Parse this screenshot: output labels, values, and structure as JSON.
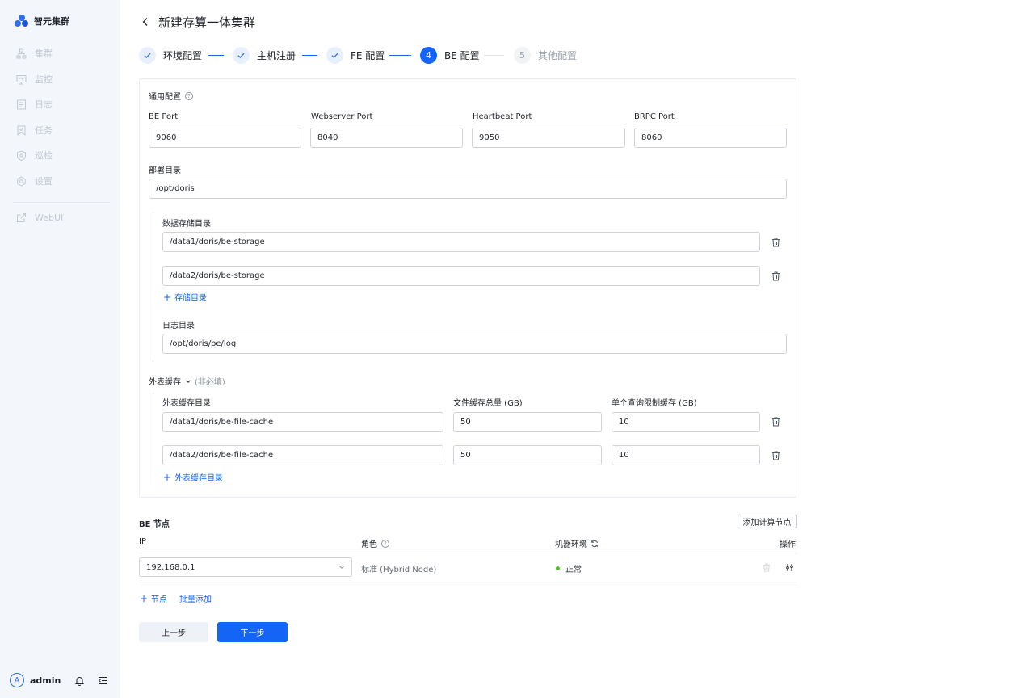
{
  "app": {
    "brand": "智元集群"
  },
  "sidebar": {
    "items": [
      {
        "label": "集群",
        "icon": "cluster-icon"
      },
      {
        "label": "监控",
        "icon": "monitor-icon"
      },
      {
        "label": "日志",
        "icon": "log-icon"
      },
      {
        "label": "任务",
        "icon": "task-icon"
      },
      {
        "label": "巡检",
        "icon": "inspect-icon"
      },
      {
        "label": "设置",
        "icon": "settings-icon"
      }
    ],
    "webui": {
      "label": "WebUI",
      "icon": "external-link-icon"
    },
    "user": {
      "avatar_letter": "A",
      "name": "admin"
    }
  },
  "header": {
    "title": "新建存算一体集群"
  },
  "steps": [
    {
      "number": "1",
      "label": "环境配置",
      "state": "done"
    },
    {
      "number": "2",
      "label": "主机注册",
      "state": "done"
    },
    {
      "number": "3",
      "label": "FE 配置",
      "state": "done"
    },
    {
      "number": "4",
      "label": "BE 配置",
      "state": "active"
    },
    {
      "number": "5",
      "label": "其他配置",
      "state": "pending"
    }
  ],
  "general": {
    "title": "通用配置",
    "ports": [
      {
        "label": "BE Port",
        "value": "9060"
      },
      {
        "label": "Webserver Port",
        "value": "8040"
      },
      {
        "label": "Heartbeat Port",
        "value": "9050"
      },
      {
        "label": "BRPC Port",
        "value": "8060"
      }
    ],
    "deploy_dir": {
      "label": "部署目录",
      "value": "/opt/doris"
    },
    "storage_dir": {
      "label": "数据存储目录",
      "values": [
        "/data1/doris/be-storage",
        "/data2/doris/be-storage"
      ],
      "add_label": "存储目录"
    },
    "log_dir": {
      "label": "日志目录",
      "value": "/opt/doris/be/log"
    }
  },
  "external_cache": {
    "title": "外表缓存",
    "optional": "(非必填)",
    "col_dir": "外表缓存目录",
    "col_total": "文件缓存总量 (GB)",
    "col_limit": "单个查询限制缓存 (GB)",
    "rows": [
      {
        "dir": "/data1/doris/be-file-cache",
        "total": "50",
        "limit": "10"
      },
      {
        "dir": "/data2/doris/be-file-cache",
        "total": "50",
        "limit": "10"
      }
    ],
    "add_label": "外表缓存目录"
  },
  "be_nodes": {
    "title": "BE 节点",
    "add_compute_label": "添加计算节点",
    "columns": {
      "ip": "IP",
      "role": "角色",
      "env": "机器环境",
      "ops": "操作"
    },
    "rows": [
      {
        "ip": "192.168.0.1",
        "role": "标准 (Hybrid Node)",
        "env": "正常"
      }
    ],
    "add_node_label": "节点",
    "batch_add_label": "批量添加"
  },
  "footer": {
    "prev_label": "上一步",
    "next_label": "下一步"
  },
  "colors": {
    "primary": "#1464f6",
    "sidebar_bg": "#f3f6fb",
    "success": "#52c41a"
  }
}
